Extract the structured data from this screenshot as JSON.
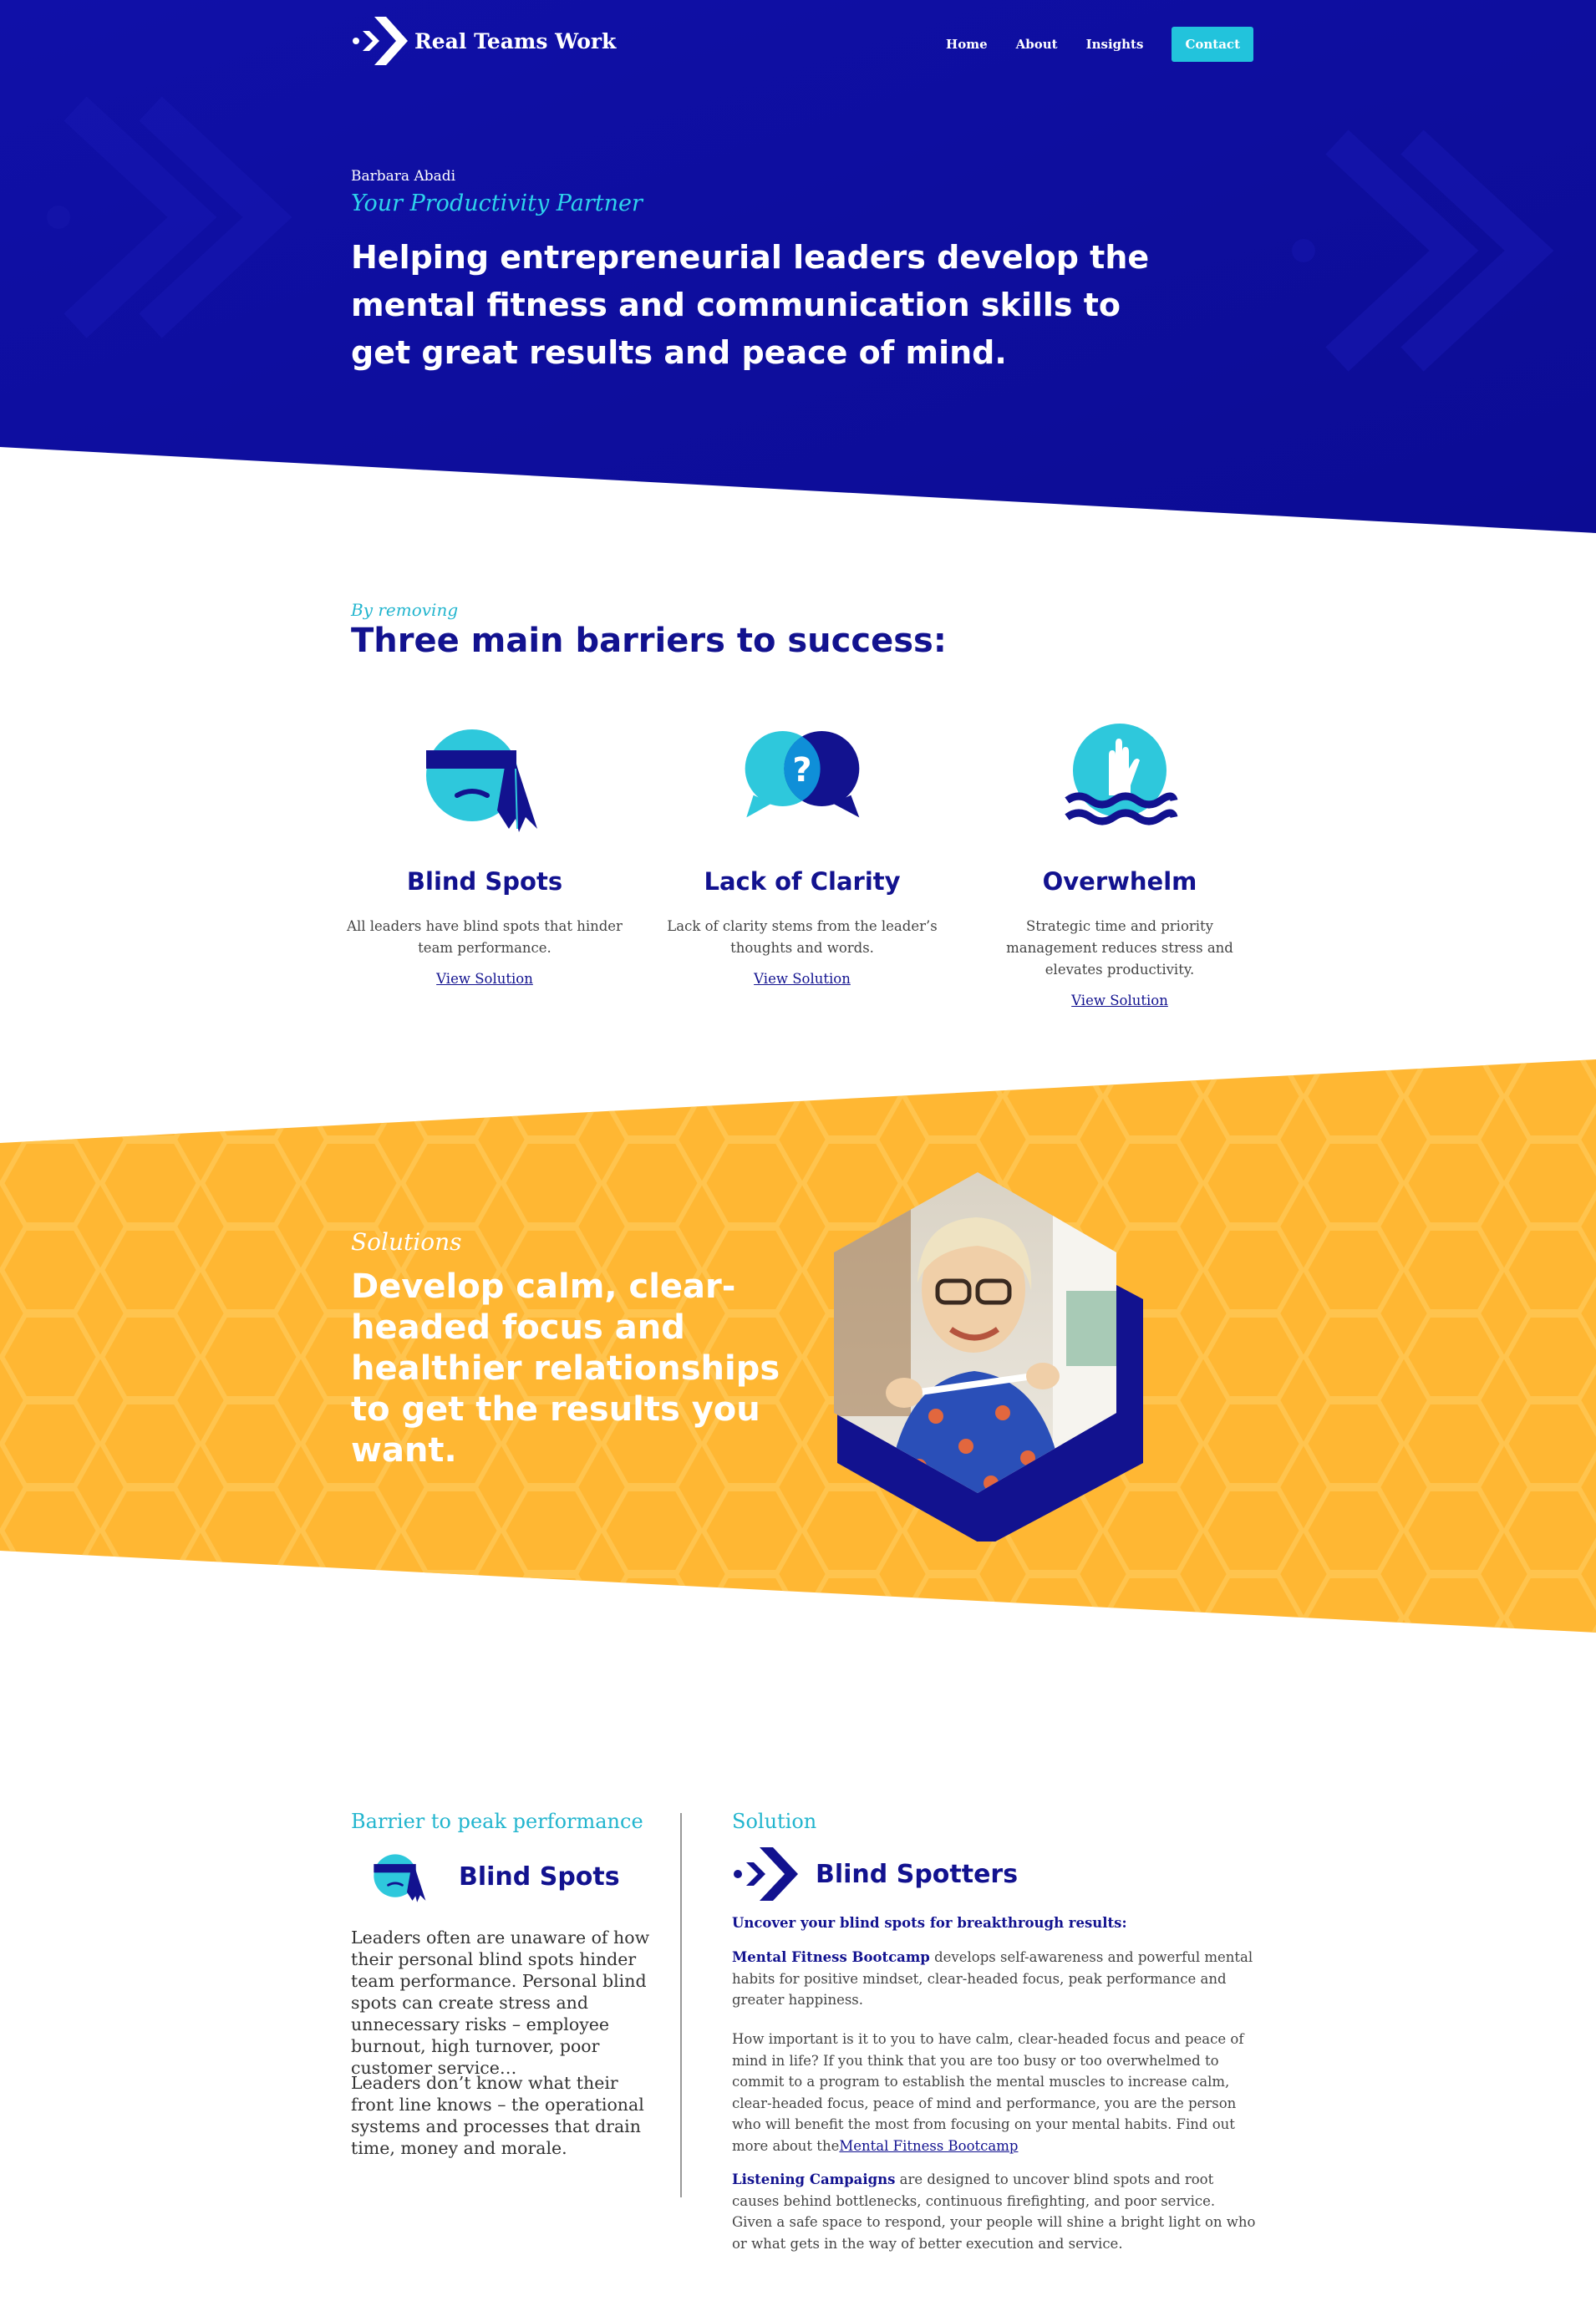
{
  "brand": {
    "name": "Real Teams Work",
    "colors": {
      "navy": "#0f0f9a",
      "cyan": "#22c3dc",
      "gold": "#ffb733"
    }
  },
  "nav": {
    "items": [
      {
        "label": "Home",
        "icon": "none"
      },
      {
        "label": "About",
        "icon": "none"
      },
      {
        "label": "Insights",
        "icon": "none"
      }
    ],
    "cta_label": "Contact"
  },
  "hero": {
    "kicker": "Barbara Abadi",
    "tagline": "Your Productivity Partner",
    "headline": "Helping entrepreneurial leaders develop the mental fitness and communication skills to get great results and peace of mind."
  },
  "barriers": {
    "kicker": "By removing",
    "title": "Three main barriers to success:",
    "cards": [
      {
        "icon": "blindfold-icon",
        "title": "Blind Spots",
        "description": "All leaders have blind spots that hinder team performance.",
        "link": "View Solution"
      },
      {
        "icon": "speech-bubbles-question-icon",
        "title": "Lack of Clarity",
        "description": "Lack of clarity stems from the leader’s thoughts and words.",
        "link": "View Solution"
      },
      {
        "icon": "drowning-hand-icon",
        "title": "Overwhelm",
        "description": "Strategic time and priority management reduces stress and elevates productivity.",
        "link": "View Solution"
      }
    ]
  },
  "solutions": {
    "kicker": "Solutions",
    "headline": "Develop calm, clear-headed focus and healthier relationships to get the results you want.",
    "photo": "portrait-photo"
  },
  "detail": {
    "left": {
      "kicker": "Barrier to peak performance",
      "title": "Blind Spots",
      "paragraphs": [
        "Leaders often are unaware of how their personal blind spots hinder team performance. Personal blind spots can create stress and unnecessary risks – employee burnout, high turnover, poor customer service…",
        "Leaders don’t know what their front line knows – the operational systems and processes that drain time, money and morale."
      ]
    },
    "right": {
      "kicker": "Solution",
      "title": "Blind Spotters",
      "subtitle": "Uncover your blind spots for breakthrough results:",
      "p1_highlight": "Mental Fitness Bootcamp",
      "p1_rest": " develops self-awareness and powerful mental habits for positive mindset, clear-headed focus, peak performance and greater happiness.",
      "p2_text": "How important is it to you to have calm, clear-headed focus and peace of mind in life? If you think that you are too busy or too overwhelmed to commit to a program to establish the mental muscles to increase calm, clear-headed focus, peace of mind and performance, you are the person who will benefit the most from focusing on your mental habits. Find out more about the",
      "p2_link": "Mental Fitness Bootcamp",
      "p3_highlight": "Listening Campaigns",
      "p3_rest": " are designed to uncover blind spots and root causes behind bottlenecks, continuous firefighting, and poor service. Given a safe space to respond, your people will shine a bright light on who or what gets in the way of better execution and service."
    }
  }
}
